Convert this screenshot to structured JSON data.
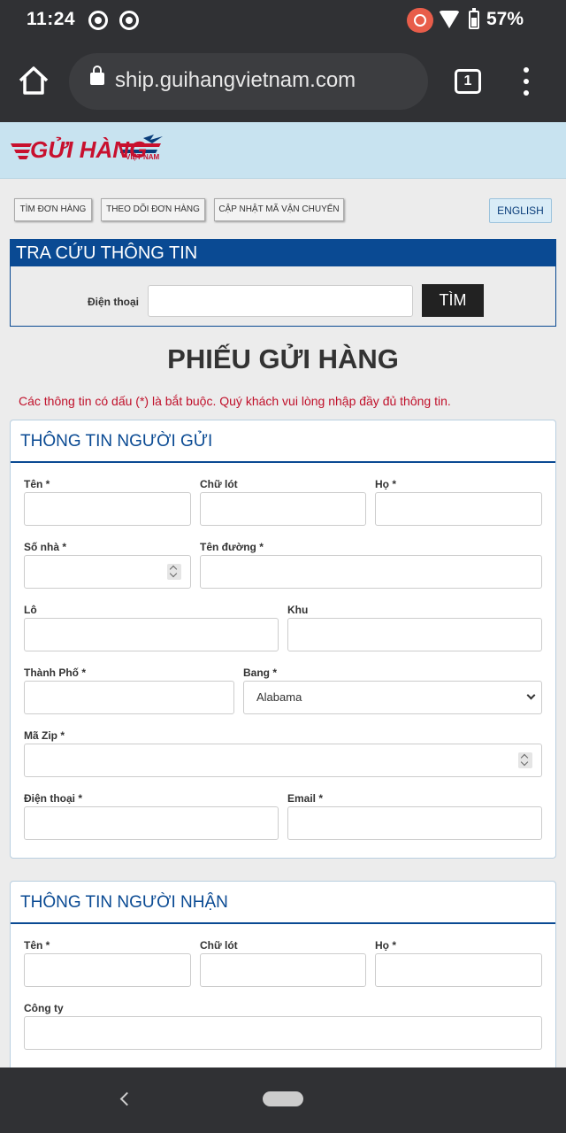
{
  "status": {
    "time": "11:24",
    "battery": "57%"
  },
  "browser": {
    "url": "ship.guihangvietnam.com",
    "tab_count": "1"
  },
  "logo": {
    "text": "GỬI HÀNG",
    "sub": "VIỆT NAM"
  },
  "nav": {
    "track_order": "TÌM ĐƠN HÀNG",
    "follow_order": "THEO DÕI ĐƠN HÀNG",
    "update_shipping": "CẬP NHẬT MÃ VẬN CHUYỂN",
    "english": "ENGLISH"
  },
  "lookup": {
    "title": "TRA CỨU THÔNG TIN",
    "phone_label": "Điện thoại",
    "search_button": "TÌM"
  },
  "form": {
    "title": "PHIẾU GỬI HÀNG",
    "notice": "Các thông tin có dấu (*) là bắt buộc. Quý khách vui lòng nhập đầy đủ thông tin."
  },
  "sender": {
    "title": "THÔNG TIN NGƯỜI GỬI",
    "first_name": "Tên *",
    "middle_name": "Chữ lót",
    "last_name": "Họ *",
    "house_no": "Số nhà *",
    "street": "Tên đường *",
    "lot": "Lô",
    "zone": "Khu",
    "city": "Thành Phố *",
    "state": "Bang *",
    "state_value": "Alabama",
    "zip": "Mã Zip *",
    "phone": "Điện thoại *",
    "email": "Email *"
  },
  "receiver": {
    "title": "THÔNG TIN NGƯỜI NHẬN",
    "first_name": "Tên *",
    "middle_name": "Chữ lót",
    "last_name": "Họ *",
    "company": "Công ty"
  }
}
